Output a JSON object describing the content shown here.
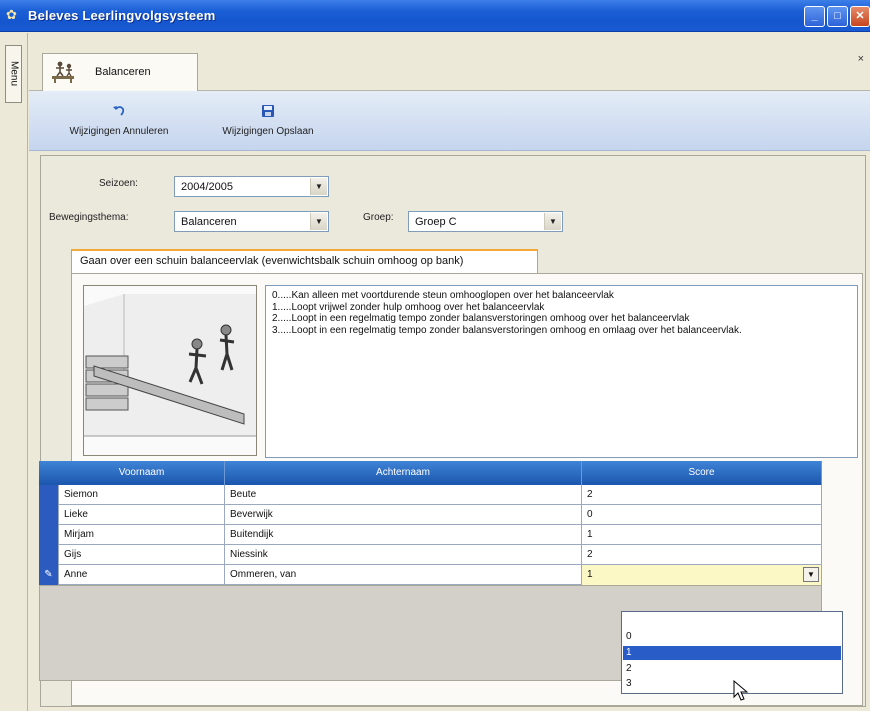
{
  "window": {
    "title": "Beleves Leerlingvolgsysteem",
    "minimize": "_",
    "maximize": "□",
    "close": "✕"
  },
  "menu": {
    "label": "Menu"
  },
  "doc_tab": {
    "label": "Balanceren",
    "close": "×"
  },
  "toolbar": {
    "undo_label": "Wijzigingen Annuleren",
    "save_label": "Wijzigingen Opslaan"
  },
  "form": {
    "seizoen_label": "Seizoen:",
    "seizoen_value": "2004/2005",
    "thema_label": "Bewegingsthema:",
    "thema_value": "Balanceren",
    "groep_label": "Groep:",
    "groep_value": "Groep C"
  },
  "exercise_tab": {
    "label": "Gaan over een schuin balanceervlak (evenwichtsbalk schuin omhoog op bank)"
  },
  "description_lines": [
    "0.....Kan alleen met voortdurende steun omhooglopen over het balanceervlak",
    "1.....Loopt vrijwel zonder hulp omhoog over het balanceervlak",
    "2.....Loopt in een regelmatig tempo zonder balansverstoringen omhoog over het balanceervlak",
    "3.....Loopt in een regelmatig tempo zonder balansverstoringen omhoog en omlaag over het balanceervlak."
  ],
  "grid": {
    "headers": [
      "Voornaam",
      "Achternaam",
      "Score"
    ],
    "rows": [
      {
        "voornaam": "Siemon",
        "achternaam": "Beute",
        "score": "2"
      },
      {
        "voornaam": "Lieke",
        "achternaam": "Beverwijk",
        "score": "0"
      },
      {
        "voornaam": "Mirjam",
        "achternaam": "Buitendijk",
        "score": "1"
      },
      {
        "voornaam": "Gijs",
        "achternaam": "Niessink",
        "score": "2"
      },
      {
        "voornaam": "Anne",
        "achternaam": "Ommeren, van",
        "score": "1"
      }
    ],
    "editing_indicator": "✎"
  },
  "score_dropdown": {
    "options": [
      "",
      "0",
      "1",
      "2",
      "3"
    ],
    "selected": "1"
  },
  "icons": {
    "app": "app-icon",
    "undo": "undo-icon",
    "save": "save-icon",
    "balance": "balance-icon"
  },
  "colors": {
    "titlebar": "#1556cf",
    "grid_header": "#1b55ad",
    "selected": "#2a5cc8",
    "edit_cell": "#fbf8c6",
    "tab_accent": "#f3a93a"
  }
}
